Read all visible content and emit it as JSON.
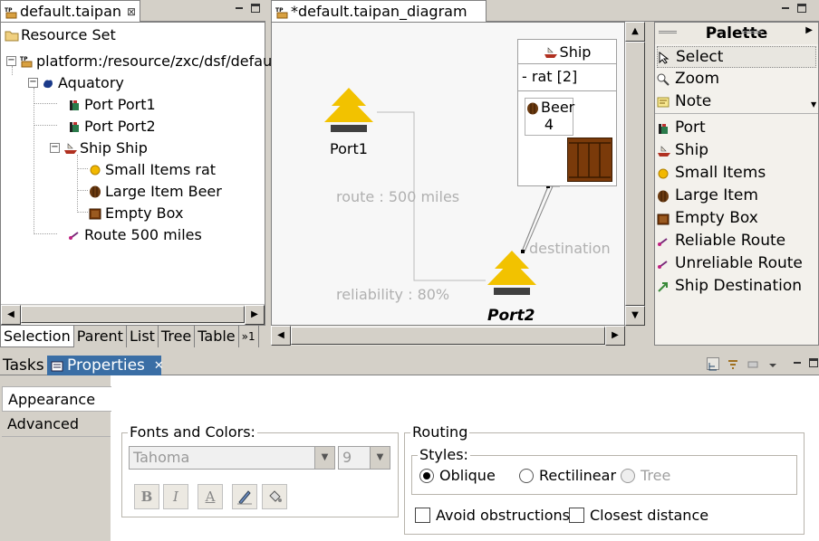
{
  "left_view": {
    "tab_title": "default.taipan",
    "close": "⊠",
    "header": "Resource Set",
    "tree": [
      {
        "label": "platform:/resource/zxc/dsf/defau",
        "icon": "taipan-file-icon"
      },
      {
        "label": "Aquatory",
        "icon": "aquatory-icon"
      },
      {
        "label": "Port Port1",
        "icon": "port-icon"
      },
      {
        "label": "Port Port2",
        "icon": "port-icon"
      },
      {
        "label": "Ship Ship",
        "icon": "ship-icon"
      },
      {
        "label": "Small Items rat",
        "icon": "small-items-icon"
      },
      {
        "label": "Large Item Beer",
        "icon": "barrel-icon"
      },
      {
        "label": "Empty Box",
        "icon": "box-icon"
      },
      {
        "label": "Route 500 miles",
        "icon": "route-icon"
      }
    ],
    "bottom_tabs": [
      "Selection",
      "Parent",
      "List",
      "Tree",
      "Table",
      "»1"
    ]
  },
  "editor": {
    "tab_title": "*default.taipan_diagram",
    "diagram": {
      "port1_label": "Port1",
      "port2_label": "Port2",
      "ship_title": "Ship",
      "ship_attr": "- rat [2]",
      "beer_name": "Beer",
      "beer_qty": "4",
      "route_label": "route : 500 miles",
      "reliability_label": "reliability : 80%",
      "destination_label": "destination"
    }
  },
  "palette": {
    "title": "Palette",
    "tools": [
      {
        "label": "Select",
        "icon": "arrow-pointer-icon"
      },
      {
        "label": "Zoom",
        "icon": "zoom-icon"
      },
      {
        "label": "Note",
        "icon": "note-icon"
      }
    ],
    "items": [
      {
        "label": "Port",
        "icon": "port-icon"
      },
      {
        "label": "Ship",
        "icon": "ship-icon"
      },
      {
        "label": "Small Items",
        "icon": "small-items-icon"
      },
      {
        "label": "Large Item",
        "icon": "barrel-icon"
      },
      {
        "label": "Empty Box",
        "icon": "box-icon"
      },
      {
        "label": "Reliable Route",
        "icon": "route-icon"
      },
      {
        "label": "Unreliable Route",
        "icon": "route-icon"
      },
      {
        "label": "Ship Destination",
        "icon": "arrow-icon"
      }
    ]
  },
  "bottom": {
    "tabs": [
      "Tasks",
      "Properties"
    ],
    "side_tabs": [
      "Appearance",
      "Advanced"
    ],
    "fonts_group": "Fonts and Colors:",
    "font_name": "Tahoma",
    "font_size": "9",
    "font_buttons": [
      "B",
      "I",
      "A"
    ],
    "routing_group": "Routing",
    "styles_group": "Styles:",
    "styles": [
      "Oblique",
      "Rectilinear",
      "Tree"
    ],
    "checks": [
      "Avoid obstructions",
      "Closest distance"
    ]
  },
  "colors": {
    "accent": "#3a6ea5",
    "port": "#f2c200",
    "box": "#7a3a0a"
  }
}
